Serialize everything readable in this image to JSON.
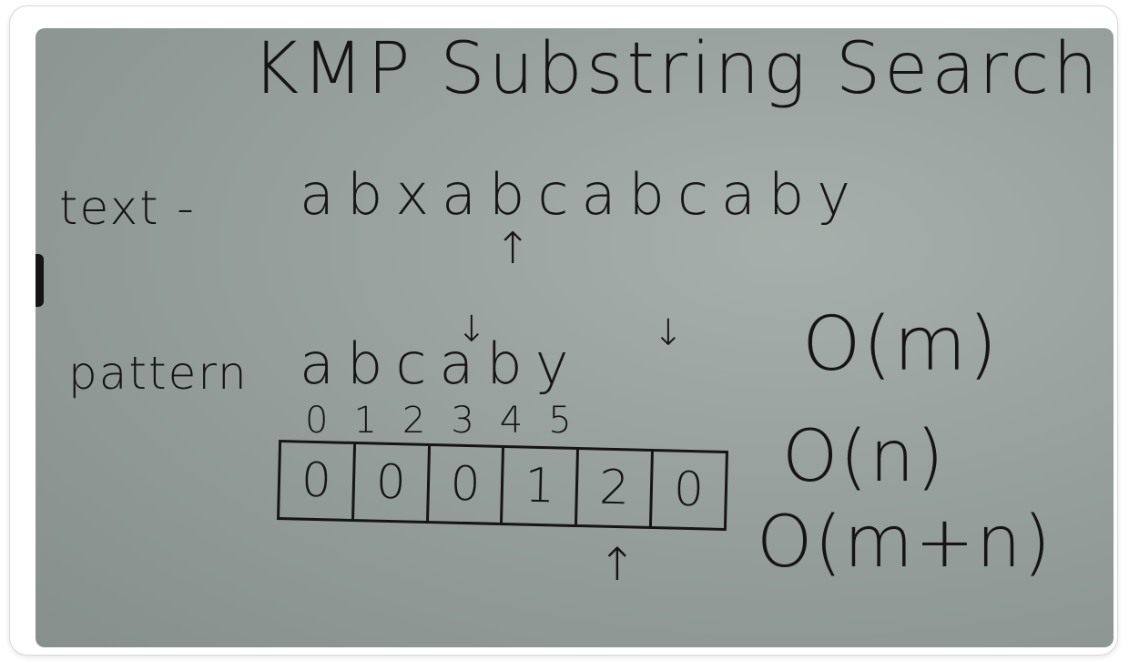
{
  "board": {
    "title": "KMP Substring Search",
    "text_label": "text -",
    "text_string": "abxabcabcaby",
    "pattern_label": "pattern",
    "pattern_string": "abcaby",
    "indices": "012345",
    "lps": [
      "0",
      "0",
      "0",
      "1",
      "2",
      "0"
    ],
    "complexity": [
      "O(m)",
      "O(n)",
      "O(m+n)"
    ],
    "arrow_up": "↑",
    "arrow_down": "↓"
  }
}
